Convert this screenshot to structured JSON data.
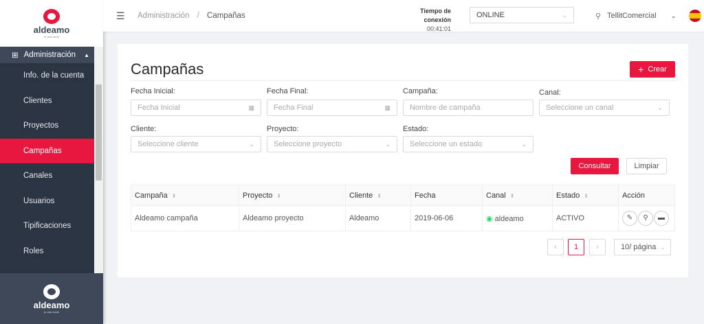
{
  "sidebar": {
    "logo": "aldeamo",
    "logo_sub": "tu vida móvil",
    "section": "Administración",
    "items": [
      "Info. de la cuenta",
      "Clientes",
      "Proyectos",
      "Campañas",
      "Canales",
      "Usuarios",
      "Tipificaciones",
      "Roles"
    ],
    "active": "Campañas"
  },
  "header": {
    "breadcrumb": [
      "Administración",
      "Campañas"
    ],
    "conn_label": "Tiempo de conexión",
    "conn_time": "00:41:01",
    "status": "ONLINE",
    "user": "TellitComercial"
  },
  "page": {
    "title": "Campañas",
    "create": "Crear",
    "filters": {
      "fecha_inicial": {
        "label": "Fecha Inicial",
        "placeholder": "Fecha Inicial"
      },
      "fecha_final": {
        "label": "Fecha Final",
        "placeholder": "Fecha Final"
      },
      "campana": {
        "label": "Campaña",
        "placeholder": "Nombre de campaña"
      },
      "canal": {
        "label": "Canal",
        "placeholder": "Seleccione un canal"
      },
      "cliente": {
        "label": "Cliente",
        "placeholder": "Seleccione cliente"
      },
      "proyecto": {
        "label": "Proyecto",
        "placeholder": "Seleccione proyecto"
      },
      "estado": {
        "label": "Estado",
        "placeholder": "Seleccione un estado"
      }
    },
    "consultar": "Consultar",
    "limpiar": "Limpiar",
    "table": {
      "headers": [
        "Campaña",
        "Proyecto",
        "Cliente",
        "Fecha",
        "Canal",
        "Estado",
        "Acción"
      ],
      "rows": [
        [
          "Aldeamo campaña",
          "Aldeamo proyecto",
          "Aldeamo",
          "2019-06-06",
          "aldeamo",
          "ACTIVO"
        ]
      ]
    },
    "pagination": {
      "current": "1",
      "page_size": "10/ página"
    }
  },
  "colors": {
    "accent": "#e8173f",
    "sidebar": "#2b3442"
  }
}
